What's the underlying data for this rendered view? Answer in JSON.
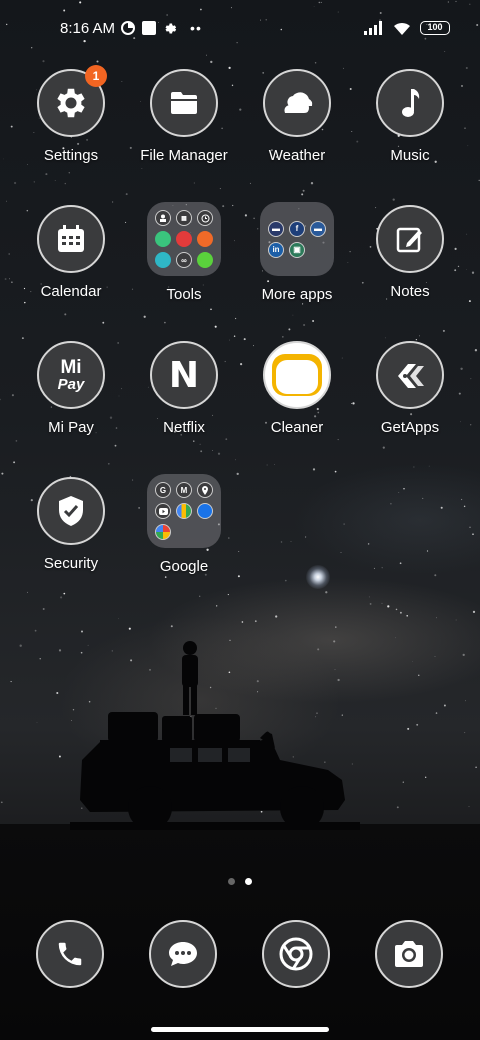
{
  "status_bar": {
    "time": "8:16 AM",
    "battery": "100",
    "icons": [
      "data-saver-icon",
      "notification-square-icon",
      "gear-icon",
      "more-dots-icon",
      "signal-icon",
      "wifi-icon",
      "battery-icon"
    ]
  },
  "apps": [
    {
      "label": "Settings",
      "icon": "gear-icon",
      "badge": "1"
    },
    {
      "label": "File Manager",
      "icon": "folder-icon"
    },
    {
      "label": "Weather",
      "icon": "cloud-sun-icon"
    },
    {
      "label": "Music",
      "icon": "music-note-icon"
    },
    {
      "label": "Calendar",
      "icon": "calendar-icon"
    },
    {
      "label": "Tools",
      "icon": "folder-tools"
    },
    {
      "label": "More apps",
      "icon": "folder-more-apps"
    },
    {
      "label": "Notes",
      "icon": "notes-edit-icon"
    },
    {
      "label": "Mi Pay",
      "icon": "mi-pay-icon",
      "logo_line1": "Mi",
      "logo_line2": "Pay"
    },
    {
      "label": "Netflix",
      "icon": "netflix-icon",
      "logo": "N"
    },
    {
      "label": "Cleaner",
      "icon": "cleaner-icon"
    },
    {
      "label": "GetApps",
      "icon": "getapps-icon"
    },
    {
      "label": "Security",
      "icon": "shield-check-icon"
    },
    {
      "label": "Google",
      "icon": "folder-google"
    }
  ],
  "folders": {
    "google_letters": [
      "G",
      "M"
    ]
  },
  "dock": [
    {
      "name": "phone",
      "icon": "phone-icon"
    },
    {
      "name": "messages",
      "icon": "chat-bubble-icon"
    },
    {
      "name": "chrome",
      "icon": "chrome-icon"
    },
    {
      "name": "camera",
      "icon": "camera-icon"
    }
  ],
  "pages": {
    "count": 2,
    "current": 2
  },
  "colors": {
    "badge": "#f26522",
    "icon_bg": "#3a3b3d",
    "icon_ring": "#d6d6d6"
  }
}
